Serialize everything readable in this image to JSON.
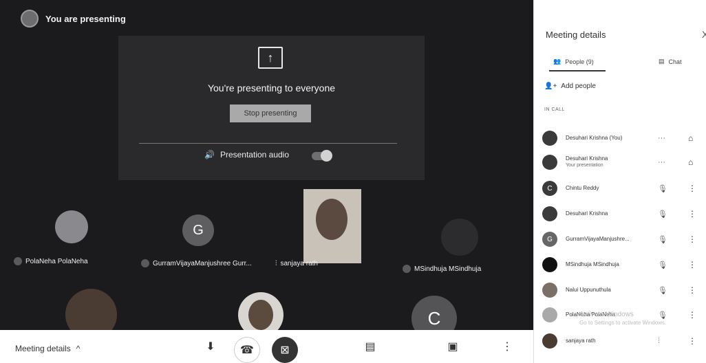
{
  "top": {
    "title": "You are presenting"
  },
  "present": {
    "message": "You're presenting to everyone",
    "stop_label": "Stop presenting",
    "audio_label": "Presentation audio",
    "audio_on": true
  },
  "tiles": [
    {
      "name": "PolaNeha PolaNeha",
      "initial": ""
    },
    {
      "name": "GurramVijayaManjushree Gurr...",
      "initial": "G"
    },
    {
      "name": "sanjaya rath",
      "initial": ""
    },
    {
      "name": "MSindhuja MSindhuja",
      "initial": ""
    },
    {
      "name": "",
      "initial": "C"
    }
  ],
  "bottom": {
    "meeting_details": "Meeting details",
    "caret": "^"
  },
  "panel": {
    "title": "Meeting details",
    "close": "X",
    "tab_people": "People (9)",
    "tab_chat": "Chat",
    "add_people": "Add people",
    "in_call": "IN CALL",
    "participants": [
      {
        "name": "Desuhari Krishna (You)",
        "sub": "",
        "initial": ""
      },
      {
        "name": "Desuhari Krishna",
        "sub": "Your presentation",
        "initial": ""
      },
      {
        "name": "Chintu Reddy",
        "sub": "",
        "initial": "C"
      },
      {
        "name": "Desuhari Krishna",
        "sub": "",
        "initial": ""
      },
      {
        "name": "GurramVijayaManjushre...",
        "sub": "",
        "initial": "G"
      },
      {
        "name": "MSindhuja MSindhuja",
        "sub": "",
        "initial": ""
      },
      {
        "name": "Nalui Uppunuthula",
        "sub": "",
        "initial": ""
      },
      {
        "name": "PolaNeha PolaNeha",
        "sub": "",
        "initial": ""
      },
      {
        "name": "sanjaya rath",
        "sub": "",
        "initial": ""
      }
    ]
  },
  "watermark": {
    "line1": "Activate Windows",
    "line2": "Go to Settings to activate Windows."
  },
  "colors": {
    "stage": "#1b1b1d",
    "present_box": "#2a2a2c",
    "panel": "#ffffff",
    "stop_button": "#a9a9a9"
  },
  "icons": [
    "present-icon",
    "audio-icon",
    "mic-off-icon",
    "pin-icon",
    "more-icon",
    "chat-icon",
    "people-icon",
    "add-person-icon",
    "hangup-icon",
    "camera-off-icon",
    "captions-icon"
  ]
}
